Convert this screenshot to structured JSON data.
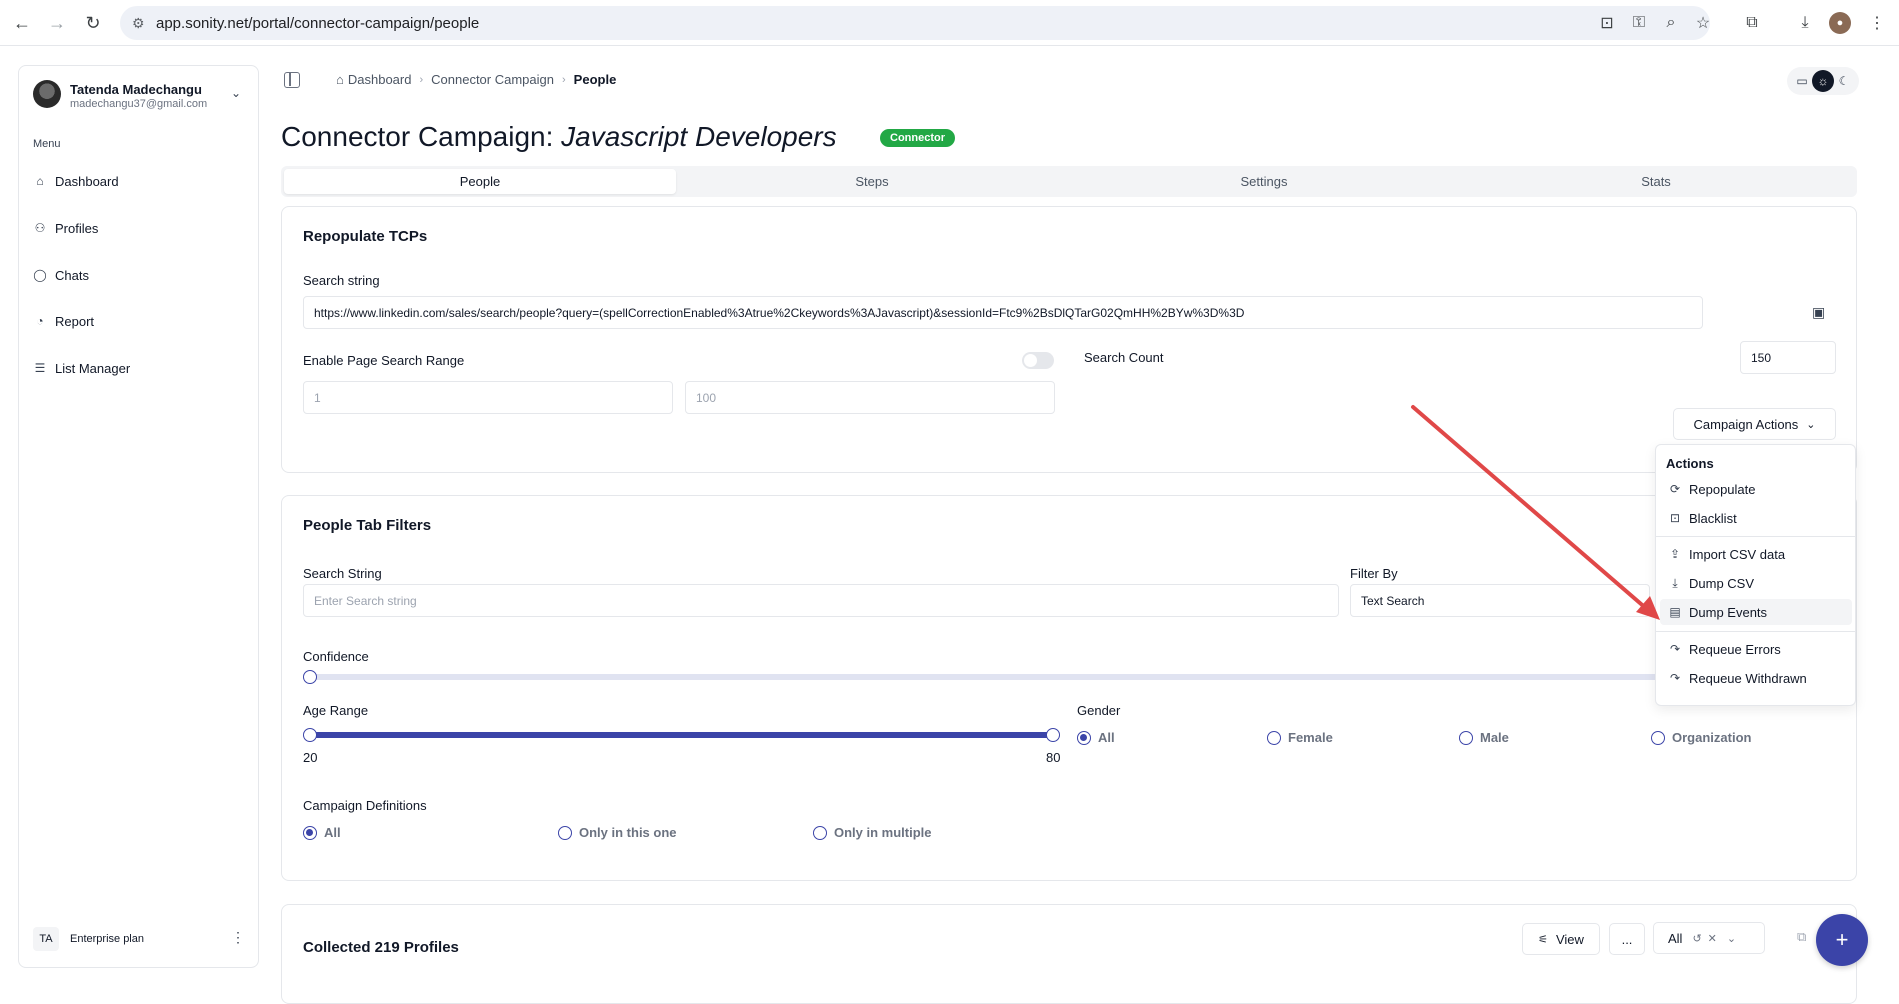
{
  "browser": {
    "url": "app.sonity.net/portal/connector-campaign/people"
  },
  "sidebar": {
    "user_name": "Tatenda Madechangu",
    "user_email": "madechangu37@gmail.com",
    "menu_label": "Menu",
    "items": [
      {
        "label": "Dashboard",
        "icon": "home-icon"
      },
      {
        "label": "Profiles",
        "icon": "users-icon"
      },
      {
        "label": "Chats",
        "icon": "chat-icon"
      },
      {
        "label": "Report",
        "icon": "chart-icon"
      },
      {
        "label": "List Manager",
        "icon": "list-icon"
      }
    ],
    "plan_initials": "TA",
    "plan_label": "Enterprise plan"
  },
  "breadcrumb": {
    "items": [
      "Dashboard",
      "Connector Campaign",
      "People"
    ]
  },
  "header": {
    "title_prefix": "Connector Campaign: ",
    "title_name": "Javascript Developers",
    "badge": "Connector"
  },
  "tabs": [
    {
      "label": "People",
      "active": true
    },
    {
      "label": "Steps",
      "active": false
    },
    {
      "label": "Settings",
      "active": false
    },
    {
      "label": "Stats",
      "active": false
    }
  ],
  "repopulate": {
    "title": "Repopulate TCPs",
    "search_label": "Search string",
    "search_value": "https://www.linkedin.com/sales/search/people?query=(spellCorrectionEnabled%3Atrue%2Ckeywords%3AJavascript)&sessionId=Ftc9%2BsDlQTarG02QmHH%2BYw%3D%3D",
    "page_range_label": "Enable Page Search Range",
    "page_range_enabled": false,
    "range_from_placeholder": "1",
    "range_to_placeholder": "100",
    "search_count_label": "Search Count",
    "search_count_value": "150",
    "campaign_actions_label": "Campaign Actions"
  },
  "actions_menu": {
    "heading": "Actions",
    "items": [
      {
        "label": "Repopulate",
        "icon": "refresh-icon"
      },
      {
        "label": "Blacklist",
        "icon": "lock-icon"
      },
      {
        "label": "Import CSV data",
        "icon": "upload-icon"
      },
      {
        "label": "Dump CSV",
        "icon": "download-icon"
      },
      {
        "label": "Dump Events",
        "icon": "file-icon"
      },
      {
        "label": "Requeue Errors",
        "icon": "redo-icon"
      },
      {
        "label": "Requeue Withdrawn",
        "icon": "redo-icon"
      }
    ],
    "highlighted": "Dump Events"
  },
  "filters": {
    "title": "People Tab Filters",
    "search_label": "Search String",
    "search_placeholder": "Enter Search string",
    "filter_by_label": "Filter By",
    "filter_by_value": "Text Search",
    "confidence_label": "Confidence",
    "age_label": "Age Range",
    "age_min": "20",
    "age_max": "80",
    "gender_label": "Gender",
    "gender_options": [
      "All",
      "Female",
      "Male",
      "Organization"
    ],
    "gender_selected": "All",
    "campaign_def_label": "Campaign Definitions",
    "campaign_def_options": [
      "All",
      "Only in this one",
      "Only in multiple"
    ],
    "campaign_def_selected": "All"
  },
  "profiles": {
    "title": "Collected 219 Profiles",
    "view_label": "View",
    "more_label": "...",
    "all_label": "All"
  },
  "colors": {
    "accent": "#3b44a8",
    "badge": "#22a845",
    "arrow": "#e04848"
  }
}
